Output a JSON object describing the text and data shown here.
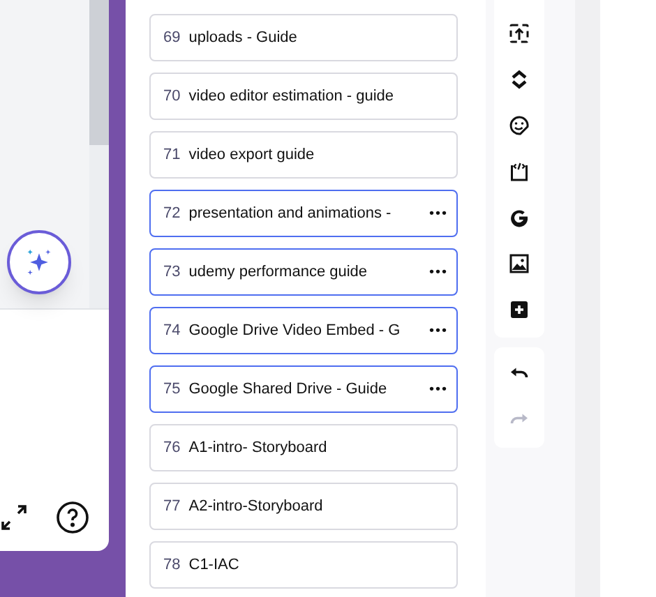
{
  "pages": [
    {
      "number": "69",
      "title": "uploads - Guide",
      "selected": false
    },
    {
      "number": "70",
      "title": "video editor estimation - guide",
      "selected": false
    },
    {
      "number": "71",
      "title": "video export guide",
      "selected": false
    },
    {
      "number": "72",
      "title": "presentation and animations -",
      "selected": true,
      "menu": "•••"
    },
    {
      "number": "73",
      "title": "udemy performance guide",
      "selected": true,
      "menu": "•••"
    },
    {
      "number": "74",
      "title": "Google Drive Video Embed - G",
      "selected": true,
      "menu": "•••"
    },
    {
      "number": "75",
      "title": "Google Shared Drive - Guide",
      "selected": true,
      "menu": "•••"
    },
    {
      "number": "76",
      "title": "A1-intro- Storyboard",
      "selected": false
    },
    {
      "number": "77",
      "title": "A2-intro-Storyboard",
      "selected": false
    },
    {
      "number": "78",
      "title": "C1-IAC",
      "selected": false
    }
  ],
  "toolbar": [
    {
      "kind": "upload"
    },
    {
      "kind": "chevrons"
    },
    {
      "kind": "sticker"
    },
    {
      "kind": "embed"
    },
    {
      "kind": "google"
    },
    {
      "kind": "image"
    },
    {
      "kind": "add"
    }
  ],
  "history": [
    {
      "kind": "undo",
      "disabled": false
    },
    {
      "kind": "redo",
      "disabled": true
    }
  ]
}
